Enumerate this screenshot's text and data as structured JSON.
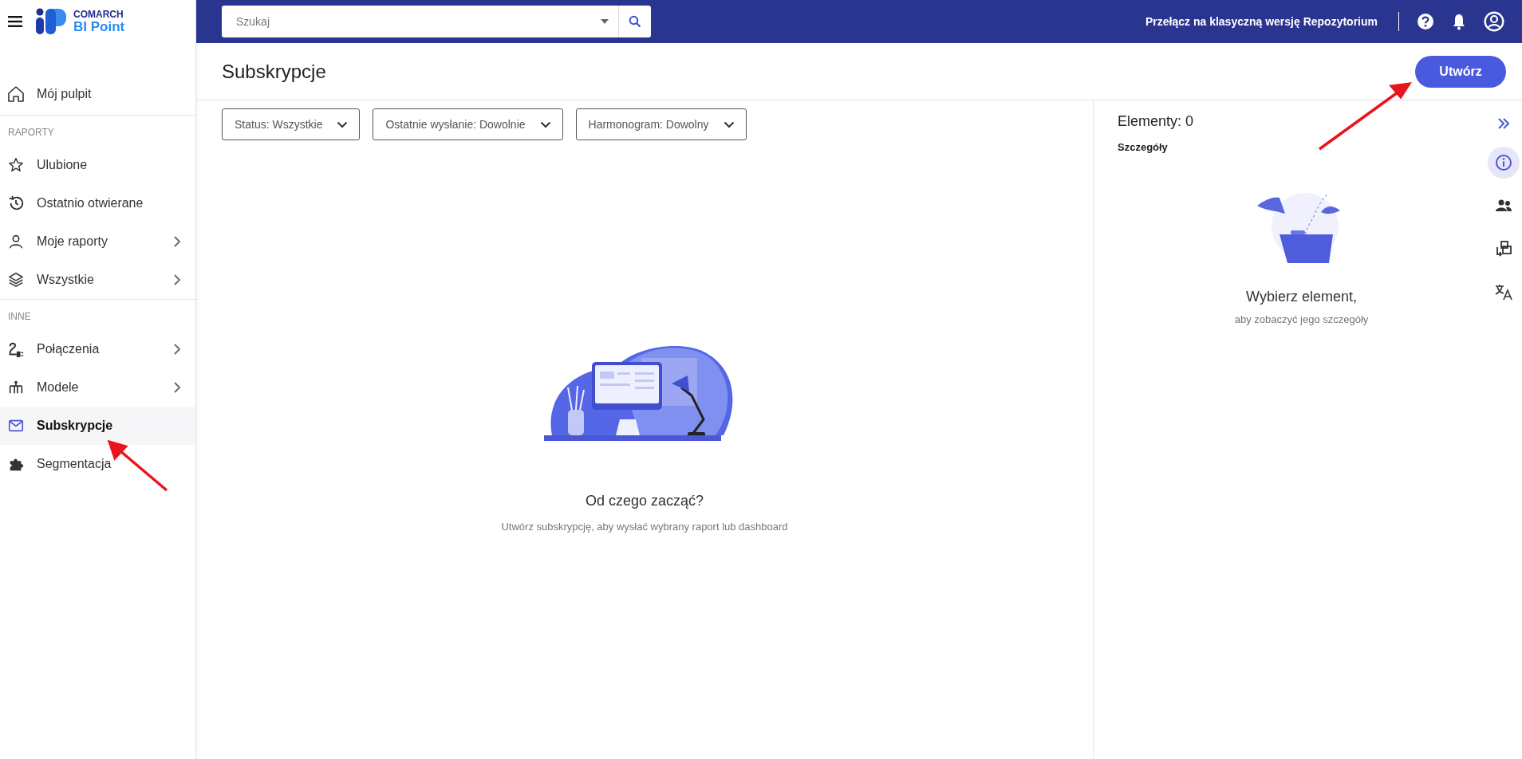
{
  "app": {
    "brand_top": "COMARCH",
    "brand_bottom": "BI Point"
  },
  "topbar": {
    "search": {
      "placeholder": "Szukaj"
    },
    "switch_link": "Przełącz na klasyczną wersję Repozytorium"
  },
  "sidebar": {
    "items": [
      {
        "label": "Mój pulpit",
        "expandable": false,
        "selected": false
      }
    ],
    "sections": [
      {
        "title": "RAPORTY",
        "items": [
          {
            "label": "Ulubione",
            "expandable": false,
            "selected": false
          },
          {
            "label": "Ostatnio otwierane",
            "expandable": false,
            "selected": false
          },
          {
            "label": "Moje raporty",
            "expandable": true,
            "selected": false
          },
          {
            "label": "Wszystkie",
            "expandable": true,
            "selected": false
          }
        ]
      },
      {
        "title": "INNE",
        "items": [
          {
            "label": "Połączenia",
            "expandable": true,
            "selected": false
          },
          {
            "label": "Modele",
            "expandable": true,
            "selected": false
          },
          {
            "label": "Subskrypcje",
            "expandable": false,
            "selected": true
          },
          {
            "label": "Segmentacja",
            "expandable": false,
            "selected": false
          }
        ]
      }
    ]
  },
  "page": {
    "title": "Subskrypcje",
    "create_button": "Utwórz"
  },
  "filters": [
    "Status: Wszystkie",
    "Ostatnie wysłanie: Dowolnie",
    "Harmonogram: Dowolny"
  ],
  "empty_state": {
    "title": "Od czego zacząć?",
    "text": "Utwórz subskrypcję, aby wysłać wybrany raport lub dashboard"
  },
  "details": {
    "count": "Elementy: 0",
    "heading": "Szczegóły",
    "title": "Wybierz element,",
    "text": "aby zobaczyć jego szczegóły"
  },
  "rail": [
    {
      "selected": true
    },
    {
      "selected": false
    },
    {
      "selected": false
    },
    {
      "selected": false
    }
  ]
}
